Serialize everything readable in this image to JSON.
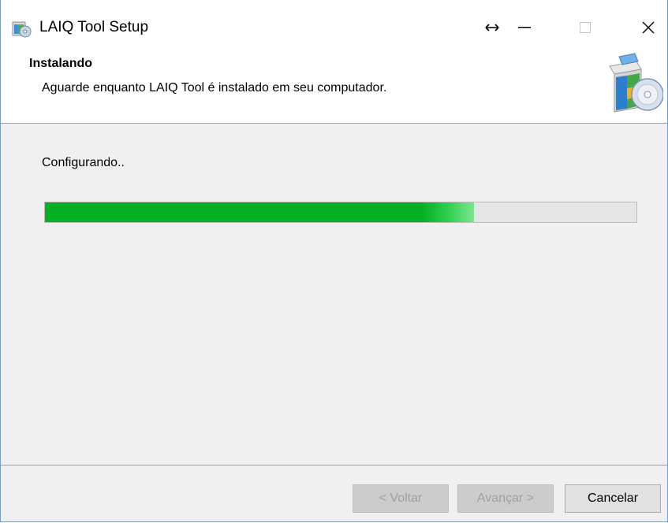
{
  "window": {
    "title": "LAIQ Tool Setup",
    "controls": {
      "resize_icon": "left-right-arrow-icon",
      "minimize_icon": "minimize-icon",
      "maximize_icon": "maximize-icon",
      "close_icon": "close-icon"
    }
  },
  "header": {
    "title": "Instalando",
    "subtitle": "Aguarde enquanto LAIQ Tool é instalado em seu computador."
  },
  "body": {
    "status": "Configurando..",
    "progress_fraction": 0.725,
    "progress_color": "#06b025"
  },
  "buttons": {
    "back": "< Voltar",
    "next": "Avançar >",
    "cancel": "Cancelar"
  }
}
